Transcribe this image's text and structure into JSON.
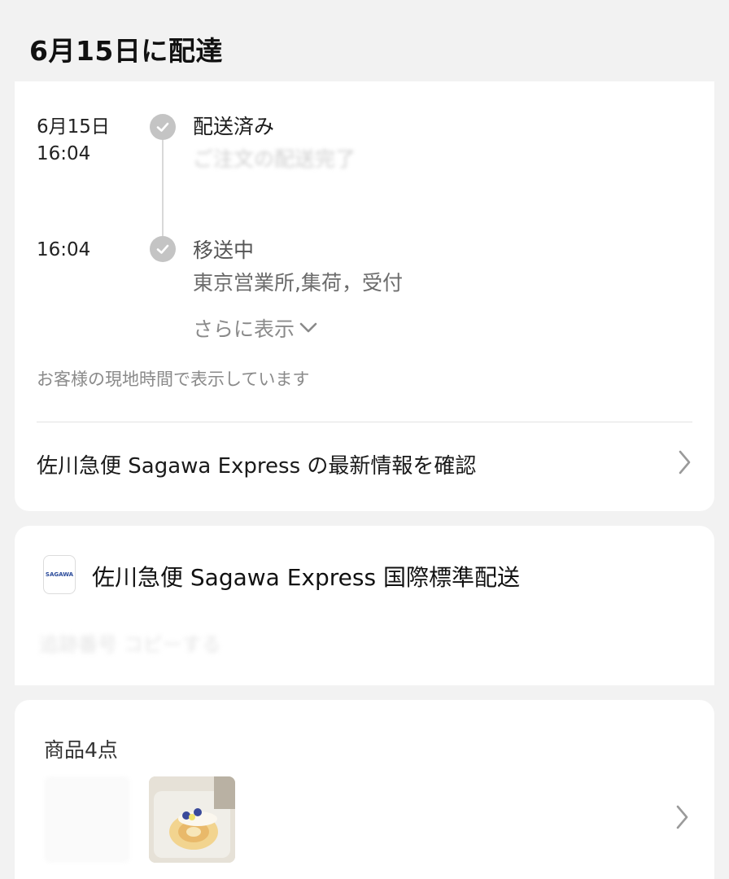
{
  "header": {
    "title": "6月15日に配達"
  },
  "tracking": {
    "events": [
      {
        "date": "6月15日",
        "time": "16:04",
        "status": "配送済み",
        "detail": "ご注文の配送完了"
      },
      {
        "date": "",
        "time": "16:04",
        "status": "移送中",
        "detail": "東京営業所,集荷，受付"
      }
    ],
    "show_more_label": "さらに表示",
    "timezone_note": "お客様の現地時間で表示しています",
    "latest_info_label": "佐川急便 Sagawa Express の最新情報を確認"
  },
  "carrier": {
    "logo_text": "SAGAWA",
    "name": "佐川急便 Sagawa Express 国際標準配送",
    "tracking_number": "追跡番号 コピーする"
  },
  "items": {
    "title": "商品4点"
  },
  "icons": {
    "check": "check-circle-icon",
    "chevron_down": "chevron-down-icon",
    "chevron_right": "chevron-right-icon"
  },
  "colors": {
    "background": "#f2f2f2",
    "card": "#ffffff",
    "check_gray": "#c4c4c4",
    "muted_text": "#8a8a8a"
  }
}
